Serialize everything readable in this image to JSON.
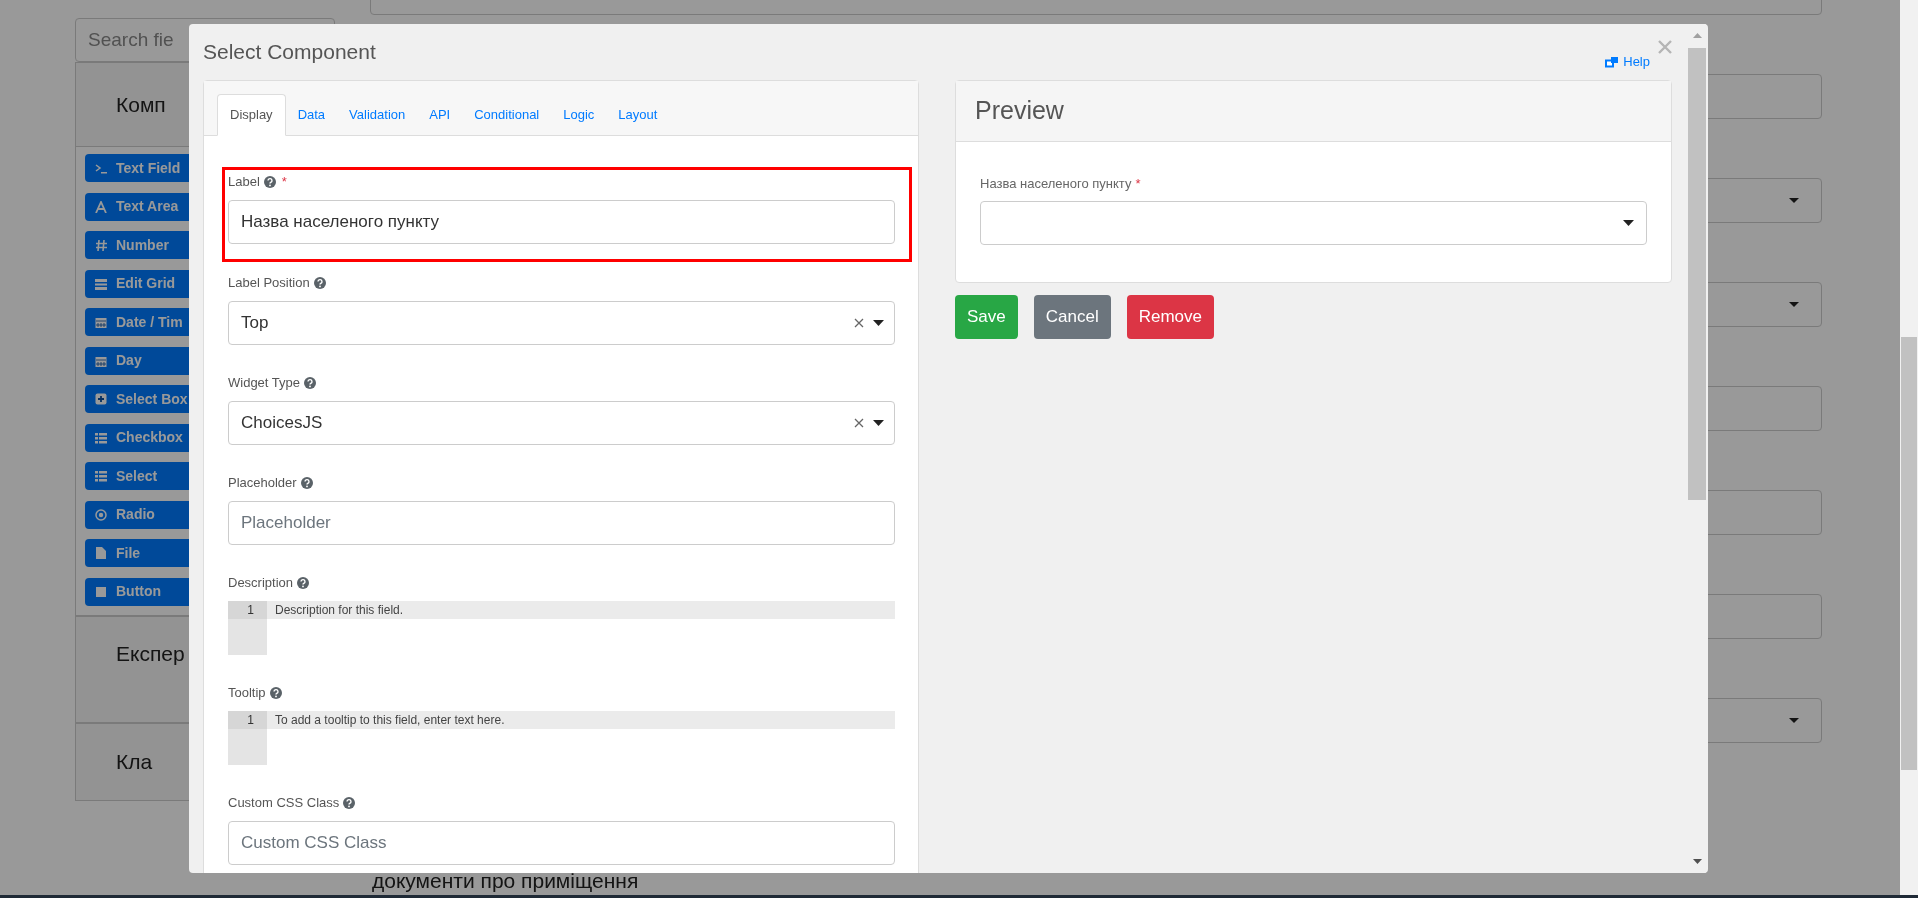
{
  "background": {
    "search_placeholder": "Search fie",
    "panels": [
      {
        "title": "Комп",
        "components": [
          {
            "label": "Text Field"
          },
          {
            "label": "Text Area"
          },
          {
            "label": "Number"
          },
          {
            "label": "Edit Grid"
          },
          {
            "label": "Date / Tim"
          },
          {
            "label": "Day"
          },
          {
            "label": "Select Box"
          },
          {
            "label": "Checkbox"
          },
          {
            "label": "Select"
          },
          {
            "label": "Radio"
          },
          {
            "label": "File"
          },
          {
            "label": "Button"
          }
        ]
      },
      {
        "title": "Експер"
      },
      {
        "title": "Кла"
      }
    ],
    "fields": [
      {
        "kind": "input"
      },
      {
        "kind": "select"
      },
      {
        "kind": "select"
      },
      {
        "kind": "input"
      },
      {
        "kind": "input"
      },
      {
        "kind": "input"
      },
      {
        "kind": "select"
      }
    ],
    "caption": "документи про приміщення"
  },
  "modal": {
    "title": "Select Component",
    "help": "Help",
    "tabs": [
      {
        "label": "Display",
        "selected": true
      },
      {
        "label": "Data",
        "selected": false
      },
      {
        "label": "Validation",
        "selected": false
      },
      {
        "label": "API",
        "selected": false
      },
      {
        "label": "Conditional",
        "selected": false
      },
      {
        "label": "Logic",
        "selected": false
      },
      {
        "label": "Layout",
        "selected": false
      }
    ],
    "form": [
      {
        "kind": "text",
        "label": "Label",
        "required_mark": "*",
        "highlighted": true,
        "value": "Назва населеного пункту"
      },
      {
        "kind": "select",
        "label": "Label Position",
        "highlighted": false,
        "value": "Top"
      },
      {
        "kind": "select",
        "label": "Widget Type",
        "highlighted": false,
        "value": "ChoicesJS"
      },
      {
        "kind": "text",
        "label": "Placeholder",
        "highlighted": false,
        "placeholder": "Placeholder"
      },
      {
        "kind": "editor",
        "label": "Description",
        "highlighted": false,
        "line_number": "1",
        "placeholder": "Description for this field."
      },
      {
        "kind": "editor",
        "label": "Tooltip",
        "highlighted": false,
        "line_number": "1",
        "placeholder": "To add a tooltip to this field, enter text here."
      },
      {
        "kind": "text",
        "label": "Custom CSS Class",
        "highlighted": false,
        "placeholder": "Custom CSS Class"
      }
    ],
    "preview": {
      "title": "Preview",
      "field_label": "Назва населеного пункту",
      "required_mark": "*"
    },
    "buttons": [
      {
        "label": "Save",
        "kind": "success"
      },
      {
        "label": "Cancel",
        "kind": "secondary"
      },
      {
        "label": "Remove",
        "kind": "danger"
      }
    ]
  }
}
